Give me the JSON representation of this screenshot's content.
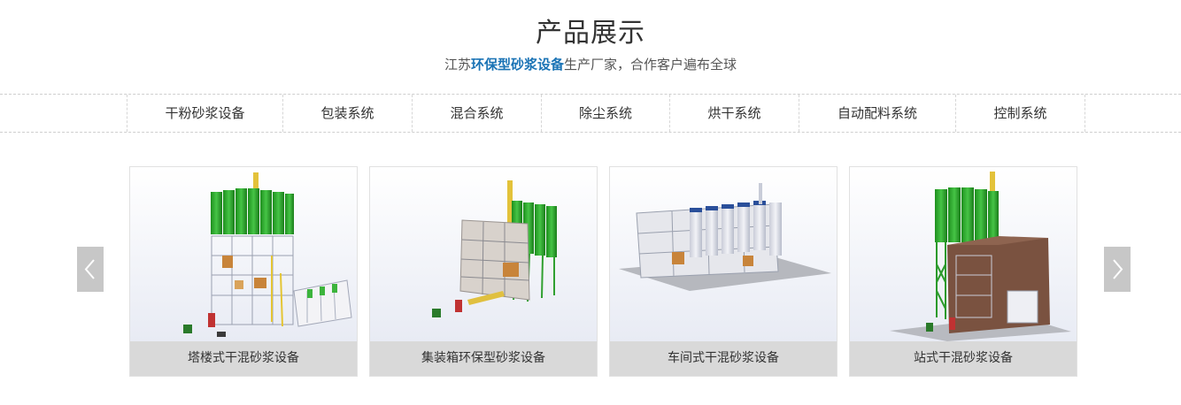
{
  "section": {
    "title": "产品展示",
    "subtitle_pre": "江苏",
    "subtitle_highlight": "环保型砂浆设备",
    "subtitle_post": "生产厂家，合作客户遍布全球"
  },
  "tabs": [
    "干粉砂浆设备",
    "包装系统",
    "混合系统",
    "除尘系统",
    "烘干系统",
    "自动配料系统",
    "控制系统"
  ],
  "products": [
    {
      "caption": "塔楼式干混砂浆设备"
    },
    {
      "caption": "集装箱环保型砂浆设备"
    },
    {
      "caption": "车间式干混砂浆设备"
    },
    {
      "caption": "站式干混砂浆设备"
    }
  ],
  "carousel": {
    "prev_icon": "chevron-left-icon",
    "next_icon": "chevron-right-icon"
  },
  "colors": {
    "accent": "#1a73b5",
    "caption_bg": "#d9d9d9",
    "arrow_bg": "#c7c7c7",
    "silo_green": "#2aa52a"
  }
}
